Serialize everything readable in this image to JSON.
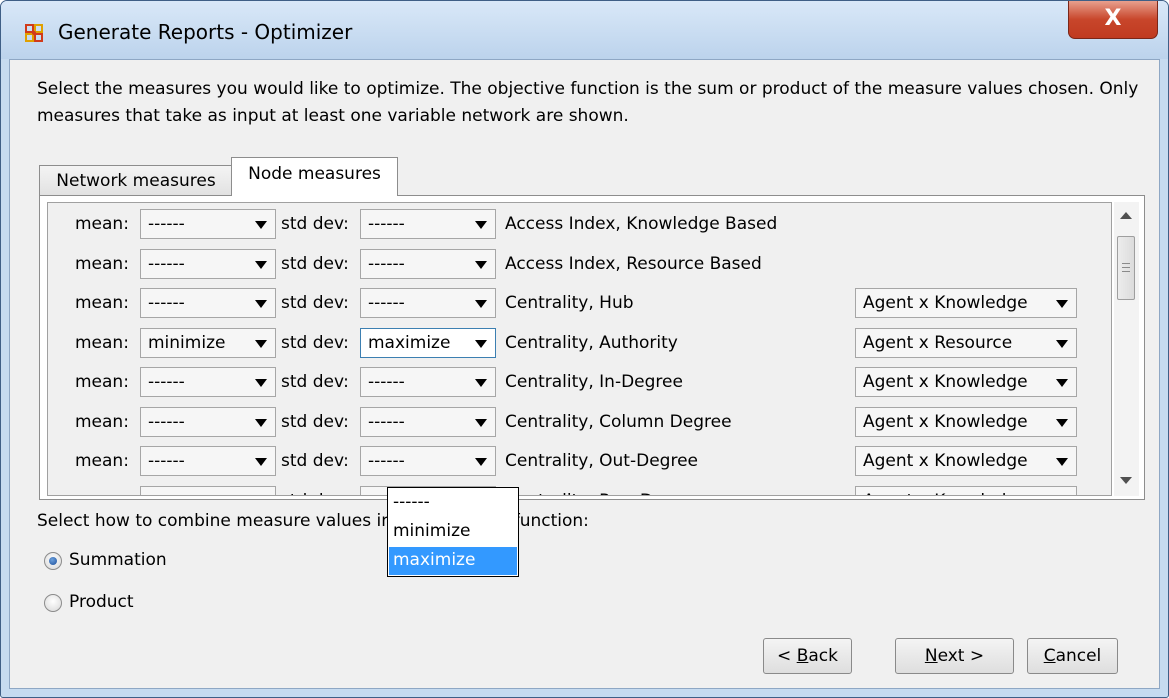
{
  "window": {
    "title": "Generate Reports - Optimizer",
    "close_label": "X"
  },
  "instructions": "Select the measures you would like to optimize. The objective function is the sum or product of the measure values chosen. Only measures that take as input at least one variable network are shown.",
  "tabs": [
    {
      "label": "Network measures",
      "selected": false
    },
    {
      "label": "Node measures",
      "selected": true
    }
  ],
  "labels": {
    "mean": "mean:",
    "std_dev": "std dev:"
  },
  "rows": [
    {
      "mean": "------",
      "std": "------",
      "measure": "Access Index, Knowledge Based",
      "network": ""
    },
    {
      "mean": "------",
      "std": "------",
      "measure": "Access Index, Resource Based",
      "network": ""
    },
    {
      "mean": "------",
      "std": "------",
      "measure": "Centrality, Hub",
      "network": "Agent x Knowledge"
    },
    {
      "mean": "minimize",
      "std": "maximize",
      "measure": "Centrality, Authority",
      "network": "Agent x Resource"
    },
    {
      "mean": "------",
      "std": "------",
      "measure": "Centrality, In-Degree",
      "network": "Agent x Knowledge"
    },
    {
      "mean": "------",
      "std": "------",
      "measure": "Centrality, Column Degree",
      "network": "Agent x Knowledge"
    },
    {
      "mean": "------",
      "std": "------",
      "measure": "Centrality, Out-Degree",
      "network": "Agent x Knowledge"
    },
    {
      "mean": "------",
      "std": "------",
      "measure": "Centrality, Row Degree",
      "network": "Agent x Knowledge"
    }
  ],
  "dropdown_popup": {
    "options": [
      "------",
      "minimize",
      "maximize"
    ],
    "highlighted": "maximize"
  },
  "combine": {
    "label": "Select how to combine measure values in the objective function:",
    "options": [
      {
        "label": "Summation",
        "selected": true
      },
      {
        "label": "Product",
        "selected": false
      }
    ]
  },
  "buttons": {
    "back": {
      "prefix": "< ",
      "mnemonic": "B",
      "rest": "ack"
    },
    "next": {
      "prefix": "",
      "mnemonic": "N",
      "rest": "ext >"
    },
    "cancel": {
      "prefix": "",
      "mnemonic": "C",
      "rest": "ancel"
    }
  },
  "colors": {
    "title_bar": "#c6dbf0",
    "close_button": "#c8462b",
    "highlight": "#3399ff"
  }
}
